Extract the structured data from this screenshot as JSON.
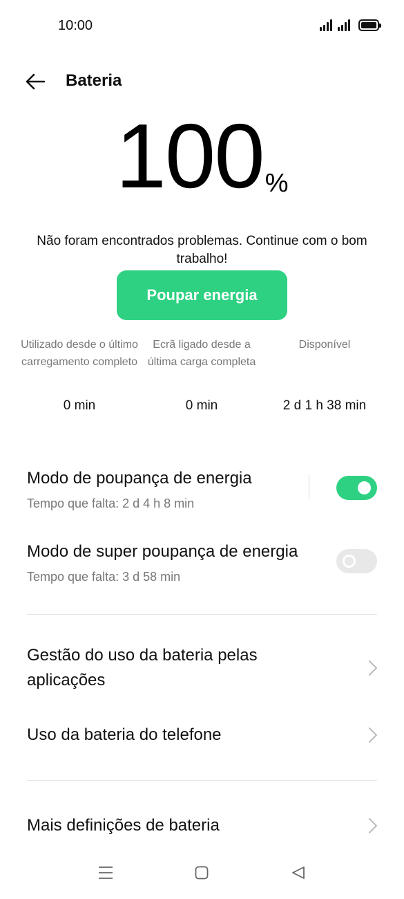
{
  "status_bar": {
    "time": "10:00",
    "icons": [
      "signal-icon",
      "signal-icon",
      "battery-icon"
    ]
  },
  "header": {
    "back_icon": "arrow-left-icon",
    "title": "Bateria"
  },
  "battery": {
    "level": "100",
    "unit": "%"
  },
  "status_message": "Não foram encontrados problemas. Continue com o bom trabalho!",
  "save_button_label": "Poupar energia",
  "accent_color": "#2ed182",
  "stats": [
    {
      "label": "Utilizado desde o último carregamento completo",
      "value": "0 min"
    },
    {
      "label": "Ecrã ligado desde a última carga completa",
      "value": "0 min"
    },
    {
      "label": "Disponível",
      "value": "2 d 1 h 38 min"
    }
  ],
  "modes": [
    {
      "title": "Modo de poupança de energia",
      "subtitle": "Tempo que falta:  2 d 4 h 8 min",
      "enabled": true
    },
    {
      "title": "Modo de super poupança de energia",
      "subtitle": "Tempo que falta:  3 d 58 min",
      "enabled": false
    }
  ],
  "menu": [
    {
      "label": "Gestão do uso da bateria pelas aplicações",
      "icon": "chevron-right-icon"
    },
    {
      "label": "Uso da bateria do telefone",
      "icon": "chevron-right-icon"
    },
    {
      "label": "Mais definições de bateria",
      "icon": "chevron-right-icon"
    }
  ],
  "system_nav": [
    "menu-icon",
    "home-icon",
    "back-triangle-icon"
  ]
}
